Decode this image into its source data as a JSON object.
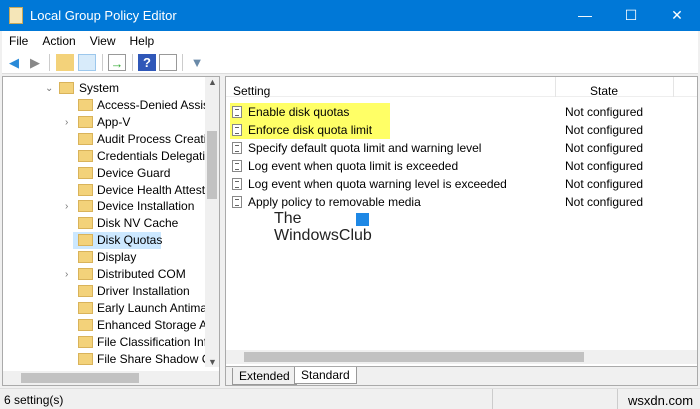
{
  "window": {
    "title": "Local Group Policy Editor",
    "minimize": "—",
    "maximize": "☐",
    "close": "✕"
  },
  "menu": [
    "File",
    "Action",
    "View",
    "Help"
  ],
  "toolbar": {
    "back": "back-icon",
    "forward": "forward-icon",
    "up": "folder-up-icon",
    "show_hide": "show-hide-tree-icon",
    "export": "export-list-icon",
    "help": "help-icon",
    "properties": "properties-icon",
    "filter": "filter-icon",
    "help_glyph": "?"
  },
  "tree": {
    "parent": "System",
    "children": [
      {
        "label": "Access-Denied Assista",
        "expandable": false
      },
      {
        "label": "App-V",
        "expandable": true
      },
      {
        "label": "Audit Process Creation",
        "expandable": false
      },
      {
        "label": "Credentials Delegation",
        "expandable": false
      },
      {
        "label": "Device Guard",
        "expandable": false
      },
      {
        "label": "Device Health Attestat",
        "expandable": false
      },
      {
        "label": "Device Installation",
        "expandable": true
      },
      {
        "label": "Disk NV Cache",
        "expandable": false
      },
      {
        "label": "Disk Quotas",
        "expandable": false,
        "selected": true
      },
      {
        "label": "Display",
        "expandable": false
      },
      {
        "label": "Distributed COM",
        "expandable": true
      },
      {
        "label": "Driver Installation",
        "expandable": false
      },
      {
        "label": "Early Launch Antimalv",
        "expandable": false
      },
      {
        "label": "Enhanced Storage Acc",
        "expandable": false
      },
      {
        "label": "File Classification Infra",
        "expandable": false
      },
      {
        "label": "File Share Shadow Cop",
        "expandable": false
      }
    ]
  },
  "list": {
    "headers": {
      "setting": "Setting",
      "state": "State"
    },
    "rows": [
      {
        "setting": "Enable disk quotas",
        "state": "Not configured",
        "highlight": true
      },
      {
        "setting": "Enforce disk quota limit",
        "state": "Not configured",
        "highlight": true
      },
      {
        "setting": "Specify default quota limit and warning level",
        "state": "Not configured"
      },
      {
        "setting": "Log event when quota limit is exceeded",
        "state": "Not configured"
      },
      {
        "setting": "Log event when quota warning level is exceeded",
        "state": "Not configured"
      },
      {
        "setting": "Apply policy to removable media",
        "state": "Not configured"
      }
    ]
  },
  "watermark": {
    "line1": "The",
    "line2": "WindowsClub"
  },
  "tabs": [
    "Extended",
    "Standard"
  ],
  "status": {
    "text": "6 setting(s)",
    "site": "wsxdn.com"
  },
  "colors": {
    "titlebar": "#0078d7",
    "highlight": "#ffff66",
    "selection": "#cce8ff"
  }
}
